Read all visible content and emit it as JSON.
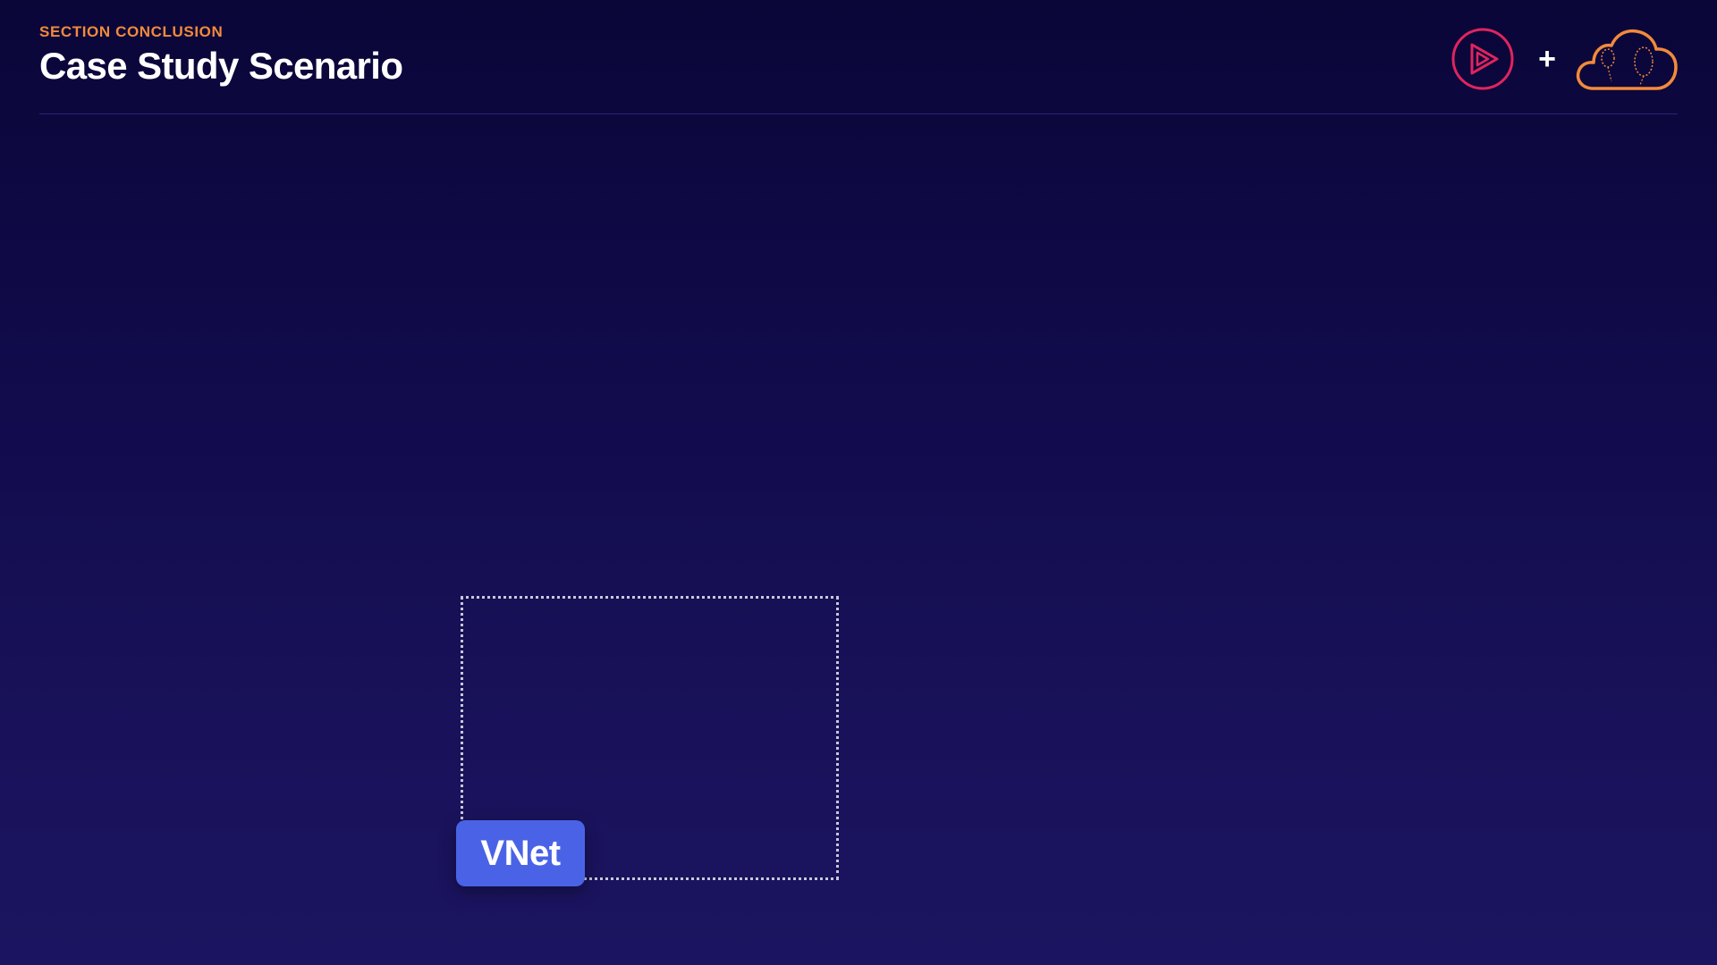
{
  "header": {
    "eyebrow": "SECTION CONCLUSION",
    "title": "Case Study Scenario"
  },
  "logos": {
    "play_icon": "pluralsight-play-icon",
    "plus": "+",
    "cloud_icon": "cloud-balloons-icon"
  },
  "diagram": {
    "vnet_label": "VNet"
  },
  "colors": {
    "accent_orange": "#f28a3b",
    "play_red": "#e0245e",
    "vnet_blue": "#4a63e6",
    "background_top": "#0a0638",
    "background_bottom": "#1b1460"
  }
}
